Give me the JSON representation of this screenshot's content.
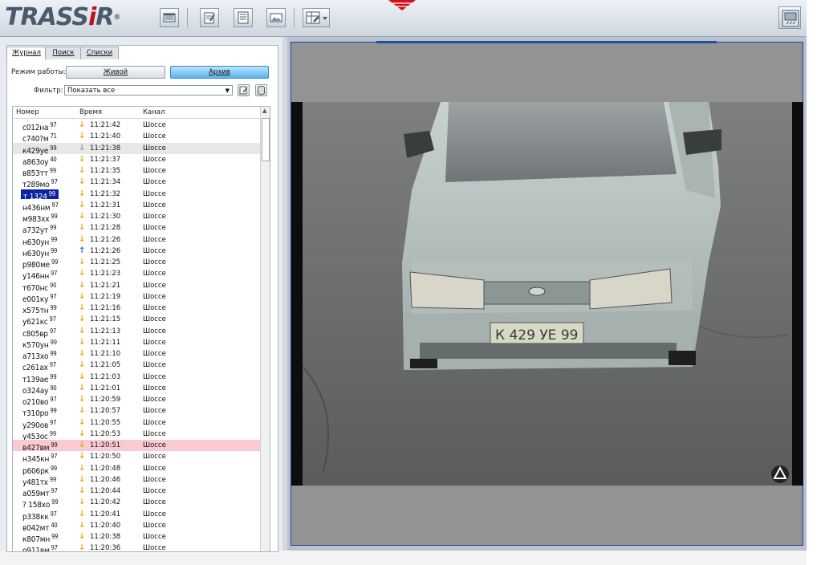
{
  "app": {
    "logo": "TRASSiR",
    "logo_mark": "®",
    "toolbar_icons": [
      "film-icon",
      "notepad-icon",
      "journal-icon",
      "picture-icon",
      "settings-menu-icon",
      "screen-mode-icon"
    ]
  },
  "tabs": [
    {
      "label": "Журнал",
      "active": true
    },
    {
      "label": "Поиск",
      "active": false
    },
    {
      "label": "Списки",
      "active": false
    }
  ],
  "mode": {
    "label": "Режим работы:",
    "live_label": "Живой",
    "archive_label": "Архив",
    "selected": "Архив"
  },
  "filter": {
    "label": "Фильтр:",
    "value": "Показать все"
  },
  "table": {
    "columns": [
      "Номер",
      "Время",
      "Канал"
    ],
    "rows": [
      {
        "plate": "с012на",
        "region": "97",
        "dir": "down",
        "time": "11:21:42",
        "channel": "Шоссе"
      },
      {
        "plate": "с740?м",
        "region": "71",
        "dir": "down",
        "time": "11:21:40",
        "channel": "Шоссе"
      },
      {
        "plate": "к429уе",
        "region": "99",
        "dir": "down-gray",
        "time": "11:21:38",
        "channel": "Шоссе",
        "state": "selected"
      },
      {
        "plate": "а863оу",
        "region": "40",
        "dir": "down",
        "time": "11:21:37",
        "channel": "Шоссе"
      },
      {
        "plate": "в853тт",
        "region": "99",
        "dir": "down",
        "time": "11:21:35",
        "channel": "Шоссе"
      },
      {
        "plate": "т289мо",
        "region": "97",
        "dir": "down",
        "time": "11:21:34",
        "channel": "Шоссе"
      },
      {
        "plate": "т 1324",
        "region": "99",
        "dir": "down",
        "time": "11:21:32",
        "channel": "Шоссе",
        "state": "highlight"
      },
      {
        "plate": "н436нм",
        "region": "97",
        "dir": "down",
        "time": "11:21:31",
        "channel": "Шоссе"
      },
      {
        "plate": "м983хх",
        "region": "99",
        "dir": "down",
        "time": "11:21:30",
        "channel": "Шоссе"
      },
      {
        "plate": "а732ут",
        "region": "99",
        "dir": "down",
        "time": "11:21:28",
        "channel": "Шоссе"
      },
      {
        "plate": "н630ун",
        "region": "99",
        "dir": "down",
        "time": "11:21:26",
        "channel": "Шоссе"
      },
      {
        "plate": "н630ун",
        "region": "99",
        "dir": "up",
        "time": "11:21:26",
        "channel": "Шоссе"
      },
      {
        "plate": "р980ме",
        "region": "99",
        "dir": "down",
        "time": "11:21:25",
        "channel": "Шоссе"
      },
      {
        "plate": "у146нн",
        "region": "97",
        "dir": "down",
        "time": "11:21:23",
        "channel": "Шоссе"
      },
      {
        "plate": "т670нс",
        "region": "90",
        "dir": "down",
        "time": "11:21:21",
        "channel": "Шоссе"
      },
      {
        "plate": "е001ку",
        "region": "97",
        "dir": "down",
        "time": "11:21:19",
        "channel": "Шоссе"
      },
      {
        "plate": "х575тн",
        "region": "99",
        "dir": "down",
        "time": "11:21:16",
        "channel": "Шоссе"
      },
      {
        "plate": "у621кс",
        "region": "97",
        "dir": "down",
        "time": "11:21:15",
        "channel": "Шоссе"
      },
      {
        "plate": "с805вр",
        "region": "97",
        "dir": "down",
        "time": "11:21:13",
        "channel": "Шоссе"
      },
      {
        "plate": "к570ун",
        "region": "99",
        "dir": "down",
        "time": "11:21:11",
        "channel": "Шоссе"
      },
      {
        "plate": "а713хо",
        "region": "99",
        "dir": "down",
        "time": "11:21:10",
        "channel": "Шоссе"
      },
      {
        "plate": "с261ах",
        "region": "97",
        "dir": "down",
        "time": "11:21:05",
        "channel": "Шоссе"
      },
      {
        "plate": "т139ае",
        "region": "99",
        "dir": "down",
        "time": "11:21:03",
        "channel": "Шоссе"
      },
      {
        "plate": "о324ау",
        "region": "90",
        "dir": "down",
        "time": "11:21:01",
        "channel": "Шоссе"
      },
      {
        "plate": "о210во",
        "region": "97",
        "dir": "down",
        "time": "11:20:59",
        "channel": "Шоссе"
      },
      {
        "plate": "т310ро",
        "region": "99",
        "dir": "down",
        "time": "11:20:57",
        "channel": "Шоссе"
      },
      {
        "plate": "у290ов",
        "region": "97",
        "dir": "down",
        "time": "11:20:55",
        "channel": "Шоссе"
      },
      {
        "plate": "у453ос",
        "region": "99",
        "dir": "down",
        "time": "11:20:53",
        "channel": "Шоссе"
      },
      {
        "plate": "в427вм",
        "region": "99",
        "dir": "down",
        "time": "11:20:51",
        "channel": "Шоссе",
        "state": "pink"
      },
      {
        "plate": "н345кн",
        "region": "97",
        "dir": "down",
        "time": "11:20:50",
        "channel": "Шоссе"
      },
      {
        "plate": "р606рк",
        "region": "99",
        "dir": "down",
        "time": "11:20:48",
        "channel": "Шоссе"
      },
      {
        "plate": "у481тх",
        "region": "99",
        "dir": "down",
        "time": "11:20:46",
        "channel": "Шоссе"
      },
      {
        "plate": "а059мт",
        "region": "97",
        "dir": "down",
        "time": "11:20:44",
        "channel": "Шоссе"
      },
      {
        "plate": "? 158хо",
        "region": "99",
        "dir": "down",
        "time": "11:20:42",
        "channel": "Шоссе"
      },
      {
        "plate": "р338кк",
        "region": "97",
        "dir": "down",
        "time": "11:20:41",
        "channel": "Шоссе"
      },
      {
        "plate": "в042мт",
        "region": "40",
        "dir": "down",
        "time": "11:20:40",
        "channel": "Шоссе"
      },
      {
        "plate": "к807мн",
        "region": "99",
        "dir": "down",
        "time": "11:20:38",
        "channel": "Шоссе"
      },
      {
        "plate": "о911вм",
        "region": "97",
        "dir": "down",
        "time": "11:20:36",
        "channel": "Шоссе"
      }
    ]
  },
  "video": {
    "license_plate_text": "К 429 УЕ 99"
  },
  "colors": {
    "arrow_down": "#e9a600",
    "arrow_up": "#2a6fb3",
    "highlight_bg": "#0b23a3",
    "pink_row": "#fbc9d2",
    "archive_button": "#58b2ef"
  }
}
